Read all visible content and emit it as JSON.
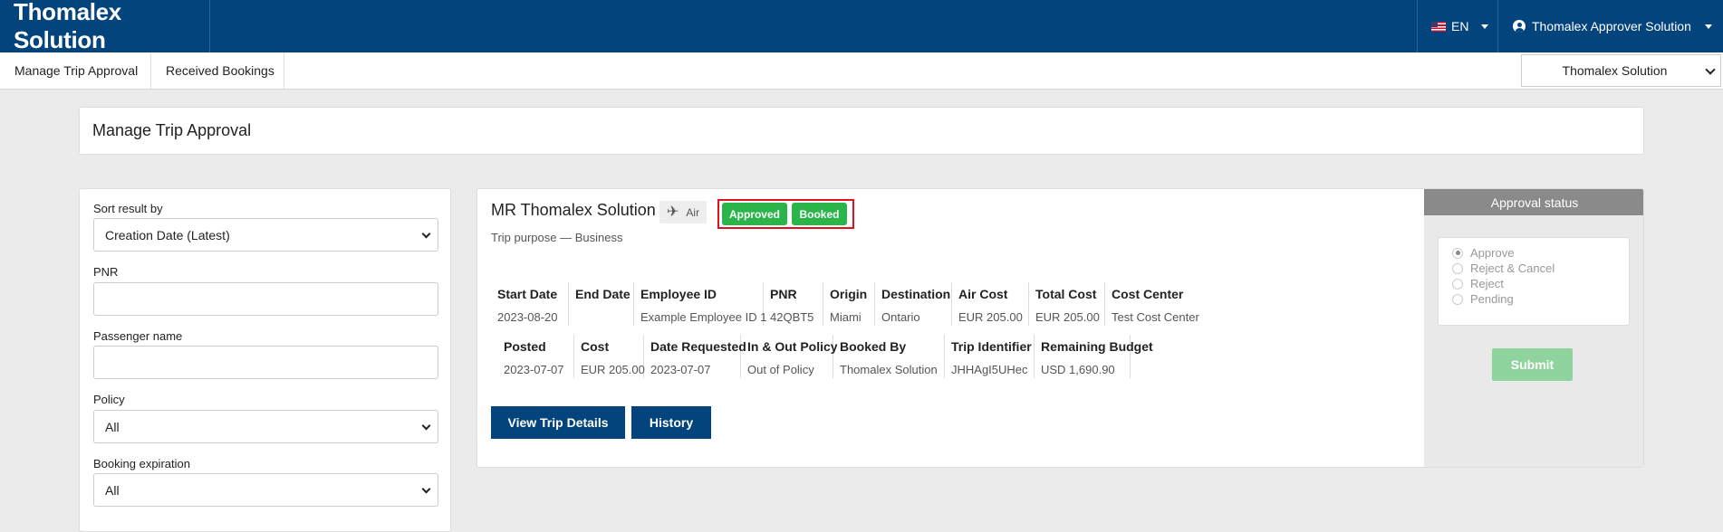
{
  "header": {
    "brand": "Thomalex Solution",
    "language": "EN",
    "user_name": "Thomalex Approver Solution"
  },
  "nav": {
    "items": [
      {
        "label": "Manage Trip Approval"
      },
      {
        "label": "Received Bookings"
      }
    ],
    "company_select": "Thomalex Solution"
  },
  "page": {
    "title": "Manage Trip Approval"
  },
  "filters": {
    "sort_label": "Sort result by",
    "sort_value": "Creation Date (Latest)",
    "pnr_label": "PNR",
    "pnr_value": "",
    "passenger_label": "Passenger name",
    "passenger_value": "",
    "policy_label": "Policy",
    "policy_value": "All",
    "expiration_label": "Booking expiration",
    "expiration_value": "All"
  },
  "trip": {
    "traveler": "MR Thomalex Solution",
    "mode": "Air",
    "mode_icon": "plane-icon",
    "status_badges": [
      "Approved",
      "Booked"
    ],
    "badge_color": "#2ab54b",
    "purpose": "Trip purpose — Business",
    "row1": [
      {
        "key": "Start Date",
        "value": "2023-08-20"
      },
      {
        "key": "End Date",
        "value": ""
      },
      {
        "key": "Employee ID",
        "value": "Example Employee ID 1"
      },
      {
        "key": "PNR",
        "value": "42QBT5"
      },
      {
        "key": "Origin",
        "value": "Miami"
      },
      {
        "key": "Destination",
        "value": "Ontario"
      },
      {
        "key": "Air Cost",
        "value": "EUR 205.00"
      },
      {
        "key": "Total Cost",
        "value": "EUR 205.00"
      },
      {
        "key": "Cost Center",
        "value": "Test Cost Center"
      }
    ],
    "row2": [
      {
        "key": "Posted",
        "value": "2023-07-07"
      },
      {
        "key": "Cost",
        "value": "EUR 205.00"
      },
      {
        "key": "Date Requested",
        "value": "2023-07-07"
      },
      {
        "key": "In & Out Policy",
        "value": "Out of Policy"
      },
      {
        "key": "Booked By",
        "value": "Thomalex Solution"
      },
      {
        "key": "Trip Identifier",
        "value": "JHHAgI5UHec"
      },
      {
        "key": "Remaining Budget",
        "value": "USD 1,690.90"
      }
    ],
    "view_details_label": "View Trip Details",
    "history_label": "History"
  },
  "approval": {
    "title": "Approval status",
    "options": [
      "Approve",
      "Reject & Cancel",
      "Reject",
      "Pending"
    ],
    "selected": "Approve",
    "submit_label": "Submit"
  },
  "colors": {
    "brand": "#04447c",
    "highlight": "#e0121f",
    "submit_disabled": "#8fd39e"
  }
}
